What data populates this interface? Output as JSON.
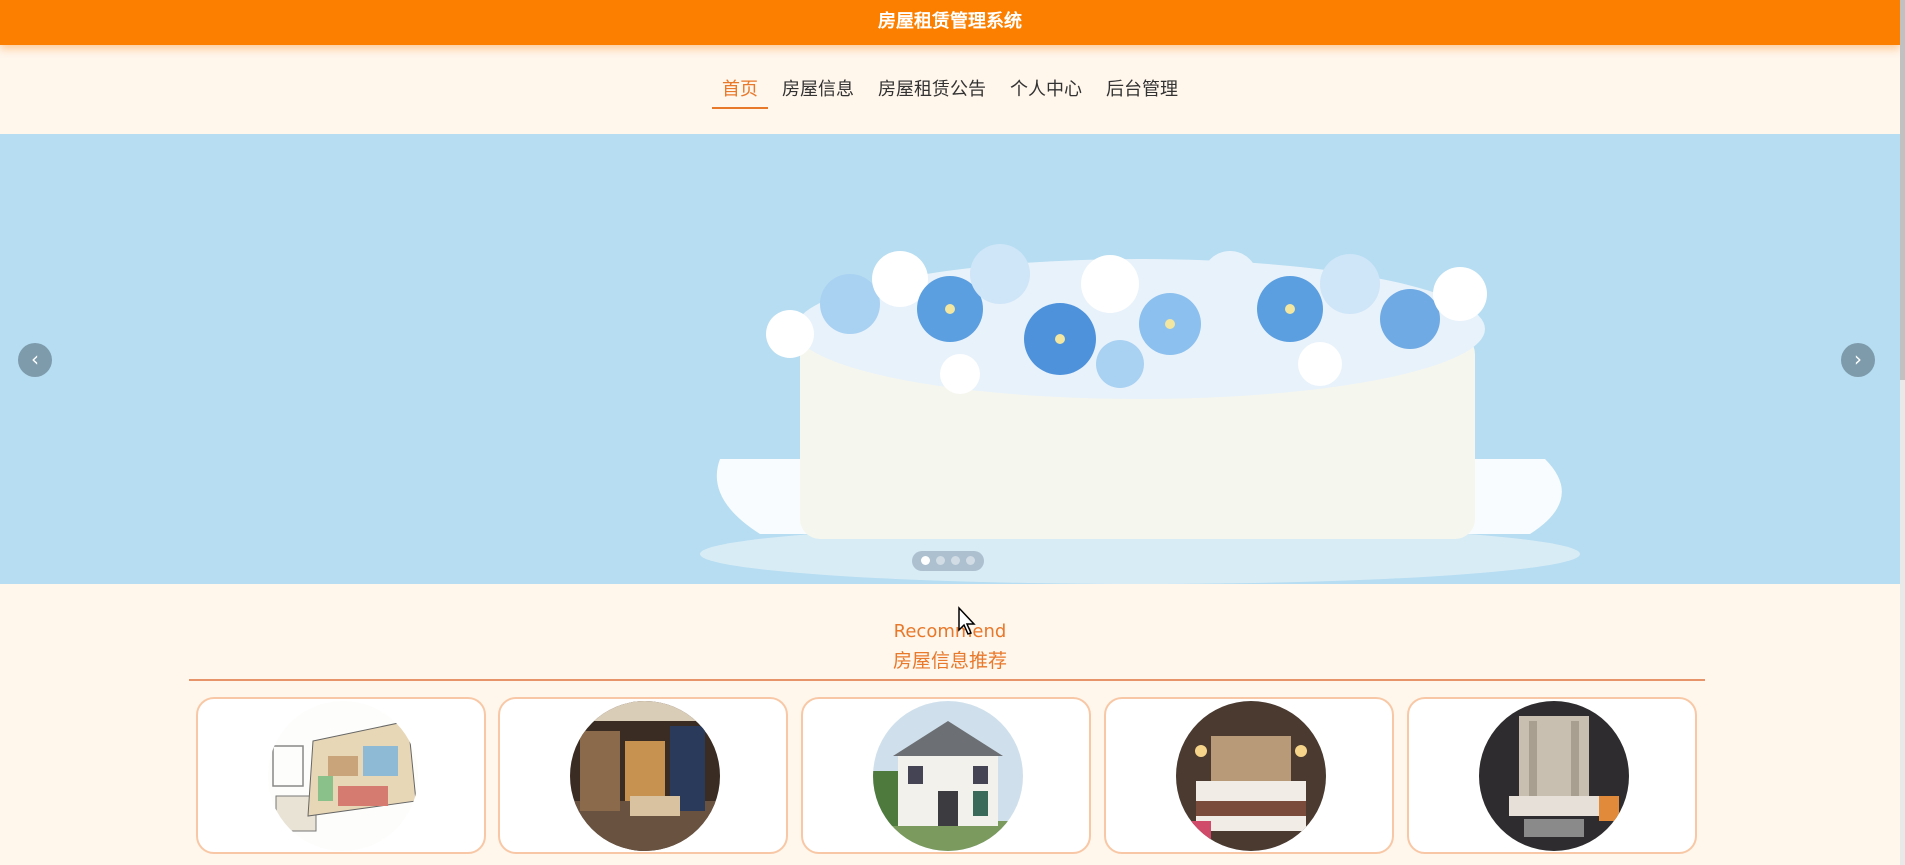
{
  "header": {
    "title": "房屋租赁管理系统"
  },
  "nav": {
    "items": [
      {
        "label": "首页",
        "active": true
      },
      {
        "label": "房屋信息"
      },
      {
        "label": "房屋租赁公告"
      },
      {
        "label": "个人中心"
      },
      {
        "label": "后台管理"
      }
    ]
  },
  "carousel": {
    "slide_count": 4,
    "active_index": 0,
    "prev_icon": "chevron-left-icon",
    "next_icon": "chevron-right-icon",
    "prev_glyph": "‹",
    "next_glyph": "›"
  },
  "recommend": {
    "title_en": "Recommend",
    "title_cn": "房屋信息推荐",
    "cards": [
      {
        "image": "floor-plan-sketch"
      },
      {
        "image": "luxury-bedroom-interior"
      },
      {
        "image": "white-villa-exterior"
      },
      {
        "image": "hotel-bedroom"
      },
      {
        "image": "modern-living-room"
      }
    ]
  },
  "colors": {
    "header_bg": "#fd7f00",
    "accent": "#e8782a",
    "page_bg": "#fff6ec",
    "banner_bg": "#b6ddf1"
  }
}
